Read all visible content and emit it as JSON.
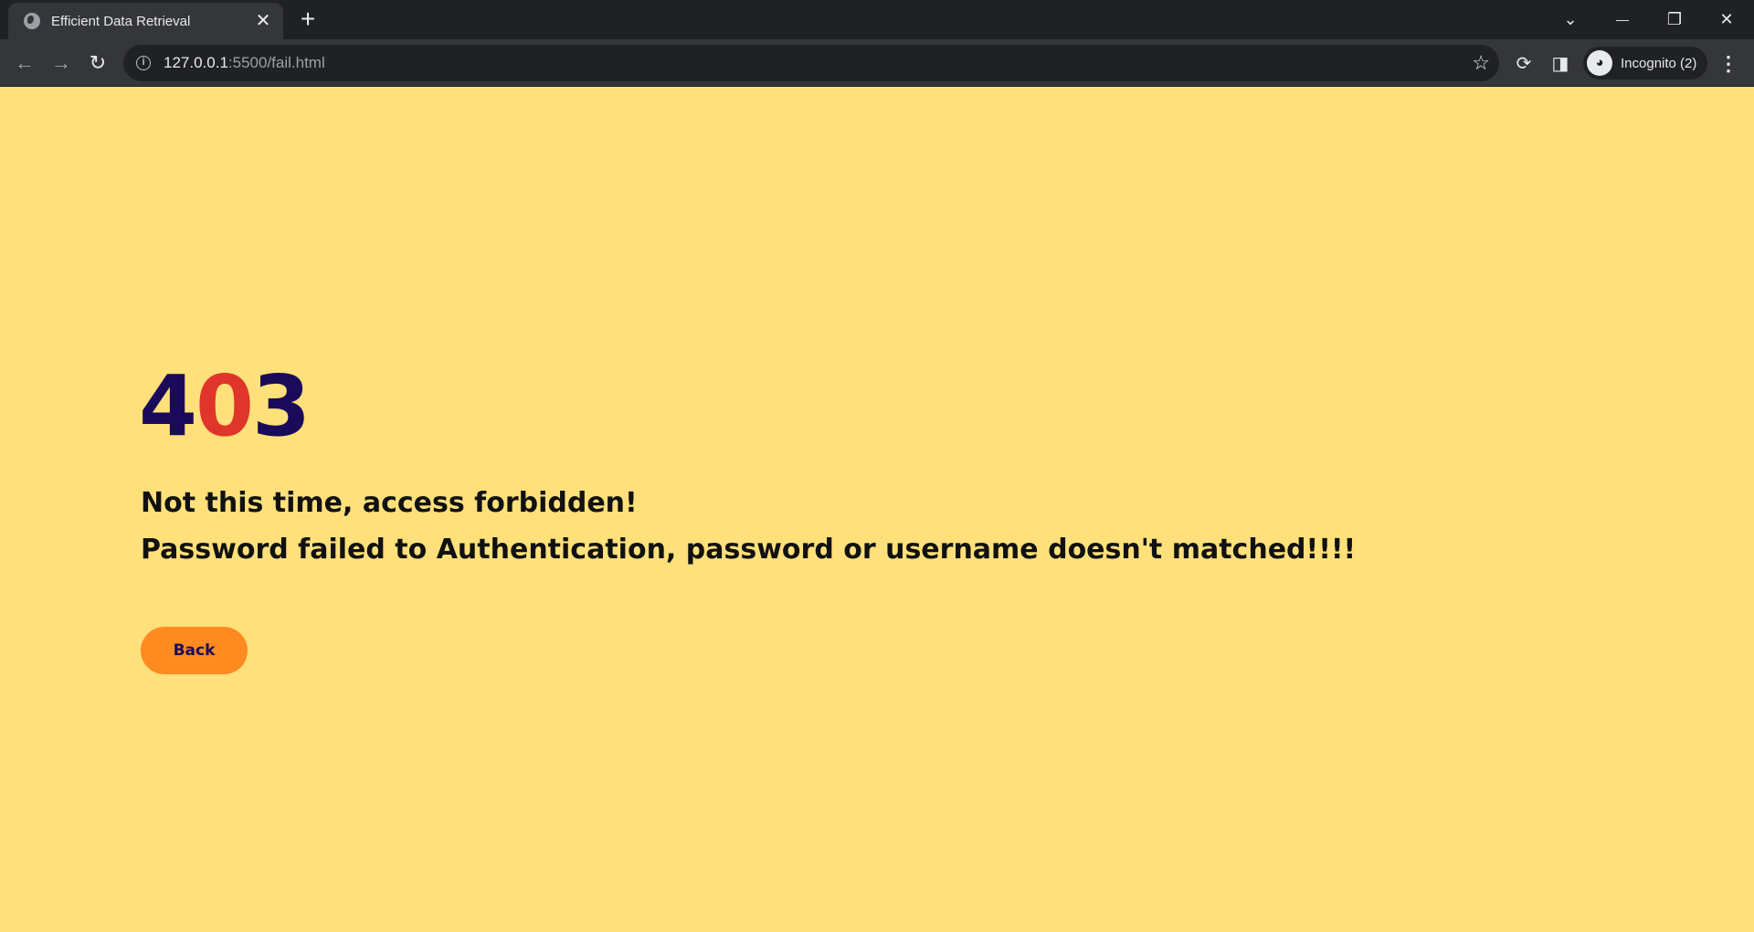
{
  "browser": {
    "tab_title": "Efficient Data Retrieval",
    "tab_close": "✕",
    "new_tab": "+",
    "url_host": "127.0.0.1",
    "url_path": ":5500/fail.html",
    "profile_label": "Incognito (2)",
    "window_controls": {
      "tab_search": "⌄",
      "minimize": "—",
      "restore": "❐",
      "close": "✕"
    }
  },
  "page": {
    "error_code": {
      "first": "4",
      "middle": "0",
      "last": "3"
    },
    "message_line1": "Not this time, access forbidden!",
    "message_line2": "Password failed to Authentication, password or username doesn't matched!!!!",
    "back_label": "Back"
  },
  "colors": {
    "background": "#ffe07a",
    "code_dark": "#1a0a5a",
    "code_red": "#e0352a",
    "button": "#ff8a1f"
  }
}
